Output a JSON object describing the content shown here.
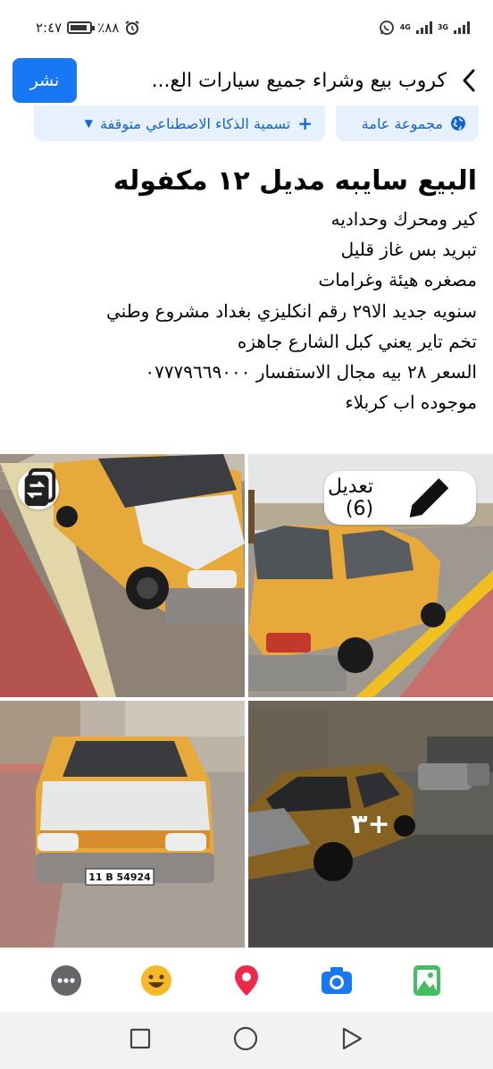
{
  "status_bar": {
    "time": "٢:٤٧",
    "battery": "٪٨٨",
    "network_1": "4G",
    "network_2": "3G"
  },
  "header": {
    "post_label": "نشر",
    "group_title": "كروب بيع وشراء جميع سيارات الع..."
  },
  "chips": {
    "privacy": "مجموعة عامة",
    "ai_label": "تسمية الذكاء الاصطناعي متوقفة"
  },
  "post": {
    "title": "البيع سايبه مديل ١٢ مكفوله",
    "lines": [
      "كير ومحرك وحداديه",
      "تبريد بس غاز قليل",
      "مصغره هيئة وغرامات",
      "سنويه جديد الا٢٩ رقم انكليزي بغداد مشروع وطني",
      "تخم تاير يعني كبل الشارع جاهزه",
      "السعر ٢٨ بيه مجال الاستفسار ٠٧٧٧٩٦٦٩٠٠٠",
      "موجوده اب كربلاء"
    ]
  },
  "photos": {
    "edit_label": "تعديل (6)",
    "more_count": "+٣",
    "plate_text": "11 B 54924"
  },
  "colors": {
    "accent": "#1877f2",
    "chip_bg": "#e7f0fd",
    "chip_text": "#1464d4",
    "taxi_yellow": "#e6a93a"
  },
  "toolbar": [
    "more-icon",
    "emoji-icon",
    "location-icon",
    "camera-icon",
    "photo-icon"
  ]
}
